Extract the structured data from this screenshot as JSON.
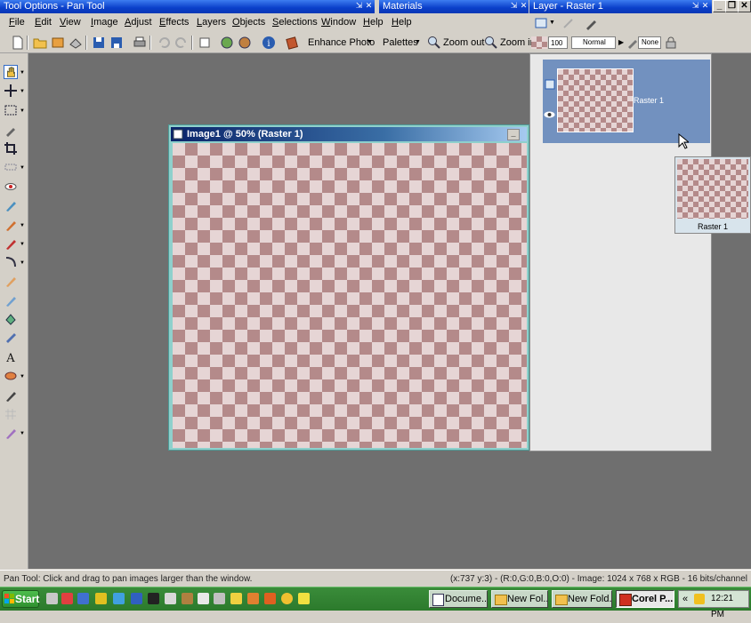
{
  "title_bars": {
    "tool_options": "Tool Options - Pan Tool",
    "materials": "Materials",
    "layer": "Layer - Raster 1"
  },
  "menu": [
    "File",
    "Edit",
    "View",
    "Image",
    "Adjust",
    "Effects",
    "Layers",
    "Objects",
    "Selections",
    "Window",
    "Help",
    "Help"
  ],
  "toolbar": {
    "enhance_photo": "Enhance Photo",
    "palettes": "Palettes",
    "zoom_out": "Zoom out",
    "zoom_in": "Zoom in",
    "opacity": "100",
    "blend_mode": "Normal",
    "mask": "None"
  },
  "image_window": {
    "title": "Image1 @  50% (Raster 1)"
  },
  "layers": {
    "layer_name": "Raster 1",
    "drag_label": "Raster 1"
  },
  "status": {
    "left": "Pan Tool: Click and drag to pan images larger than the window.",
    "right": "(x:737 y:3) - (R:0,G:0,B:0,O:0) - Image:  1024 x 768 x RGB - 16 bits/channel"
  },
  "taskbar": {
    "start": "Start",
    "tasks": [
      "Docume...",
      "New Fol...",
      "New Fold...",
      "Corel P..."
    ],
    "clock": "12:21 PM",
    "tray_chevron": "«"
  },
  "colors": {
    "title_blue": "#0a3fc9",
    "workspace": "#6f6f6f",
    "layer_selected": "#7291bf",
    "checker_dark": "#b48a8a",
    "checker_light": "#e6d5d5",
    "taskbar_green": "#2c7a2c"
  }
}
